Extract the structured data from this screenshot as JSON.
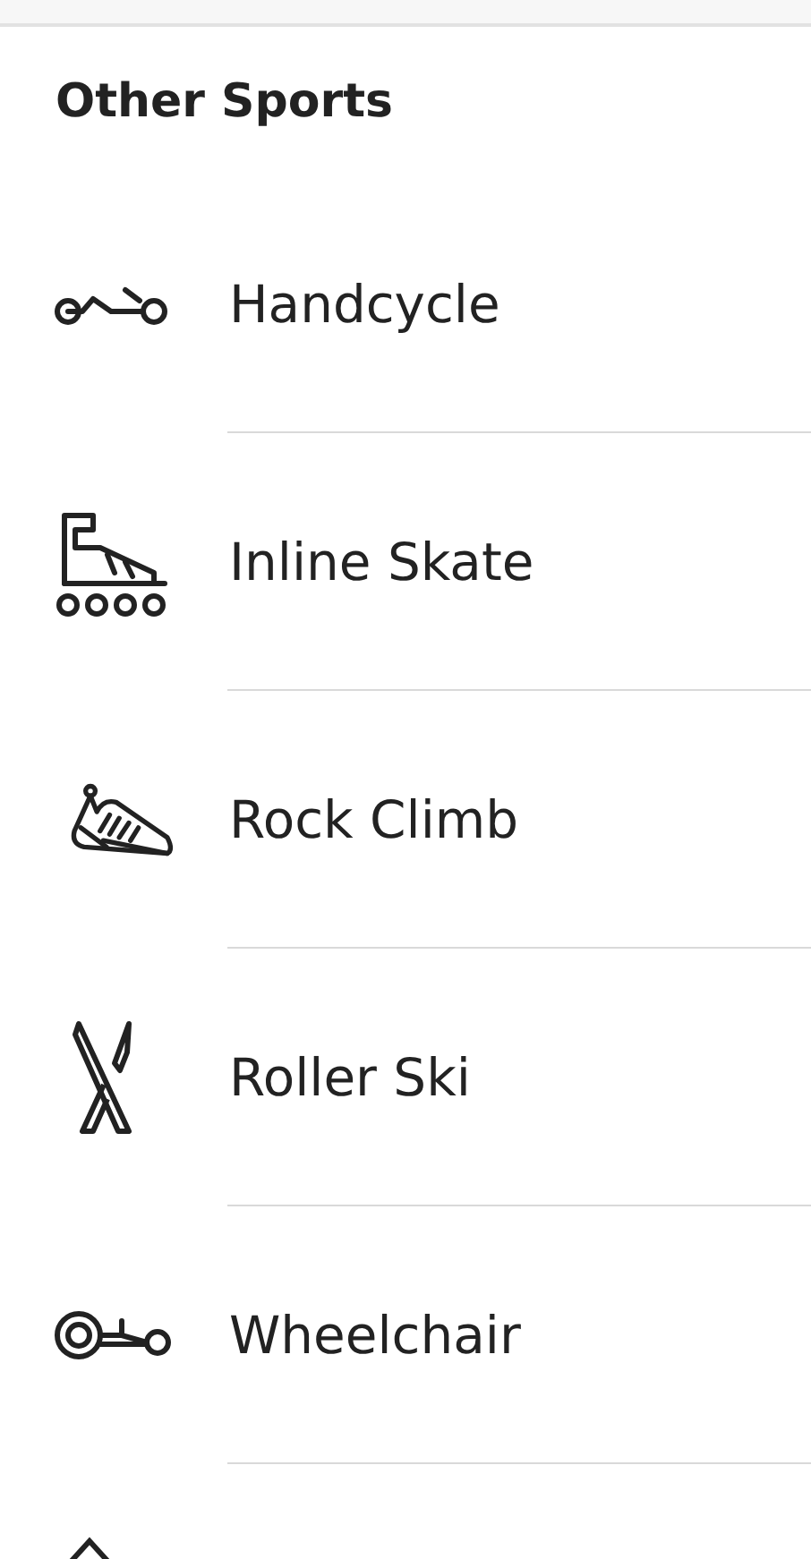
{
  "section": {
    "title": "Other Sports"
  },
  "sports": [
    {
      "kind": "handcycle",
      "label": "Handcycle"
    },
    {
      "kind": "inline-skate",
      "label": "Inline Skate"
    },
    {
      "kind": "rock-climb",
      "label": "Rock Climb"
    },
    {
      "kind": "roller-ski",
      "label": "Roller Ski"
    },
    {
      "kind": "wheelchair",
      "label": "Wheelchair"
    },
    {
      "kind": "peak"
    }
  ]
}
